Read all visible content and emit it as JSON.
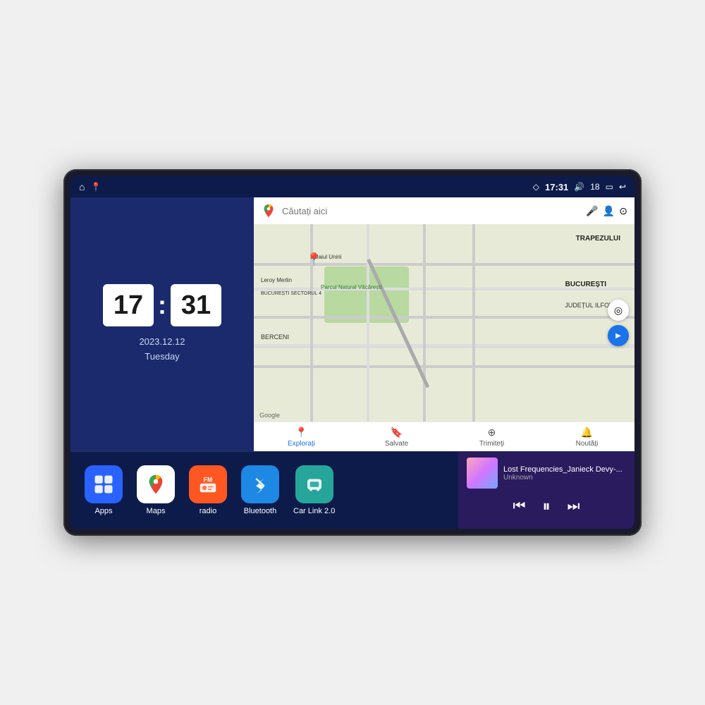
{
  "device": {
    "screen_bg": "#0d1b4b"
  },
  "status_bar": {
    "location_icon": "◇",
    "time": "17:31",
    "volume_icon": "🔊",
    "volume_level": "18",
    "battery_icon": "🔋",
    "back_icon": "↩"
  },
  "clock": {
    "hours": "17",
    "minutes": "31",
    "date": "2023.12.12",
    "day": "Tuesday"
  },
  "map": {
    "search_placeholder": "Căutați aici",
    "tabs": [
      {
        "label": "Explorați",
        "icon": "📍",
        "active": true
      },
      {
        "label": "Salvate",
        "icon": "🔖",
        "active": false
      },
      {
        "label": "Trimiteți",
        "icon": "⊕",
        "active": false
      },
      {
        "label": "Noutăți",
        "icon": "🔔",
        "active": false
      }
    ],
    "labels": [
      "TRAPEZULUI",
      "BUCUREȘTI",
      "JUDEȚUL ILFOV",
      "BERCENI",
      "Parcul Natural Văcărești",
      "Leroy Merlin",
      "BUCUREȘTI SECTORUL 4"
    ]
  },
  "apps": [
    {
      "id": "apps",
      "label": "Apps",
      "icon": "⊞",
      "color": "#2962ff"
    },
    {
      "id": "maps",
      "label": "Maps",
      "icon": "📍",
      "color": "#ffffff"
    },
    {
      "id": "radio",
      "label": "radio",
      "icon": "📻",
      "color": "#ff5722"
    },
    {
      "id": "bluetooth",
      "label": "Bluetooth",
      "icon": "₿",
      "color": "#1e88e5"
    },
    {
      "id": "carlink",
      "label": "Car Link 2.0",
      "icon": "🔗",
      "color": "#26a69a"
    }
  ],
  "music": {
    "title": "Lost Frequencies_Janieck Devy-...",
    "artist": "Unknown",
    "prev_icon": "⏮",
    "play_icon": "⏸",
    "next_icon": "⏭"
  }
}
